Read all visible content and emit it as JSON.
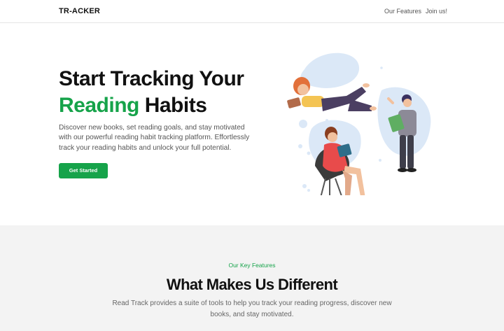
{
  "nav": {
    "logo": "TR-ACKER",
    "links": [
      "Our Features",
      "Join us!"
    ]
  },
  "hero": {
    "title_line1": "Start Tracking Your",
    "title_accent": "Reading",
    "title_rest": " Habits",
    "description": "Discover new books, set reading goals, and stay motivated with our powerful reading habit tracking platform. Effortlessly track your reading habits and unlock your full potential.",
    "cta_label": "Get Started"
  },
  "features": {
    "eyebrow": "Our Key Features",
    "title": "What Makes Us Different",
    "description": "Read Track provides a suite of tools to help you track your reading progress, discover new books, and stay motivated."
  },
  "colors": {
    "accent": "#16a34a",
    "section_bg": "#f3f3f3",
    "blob": "#dbe8f7"
  }
}
